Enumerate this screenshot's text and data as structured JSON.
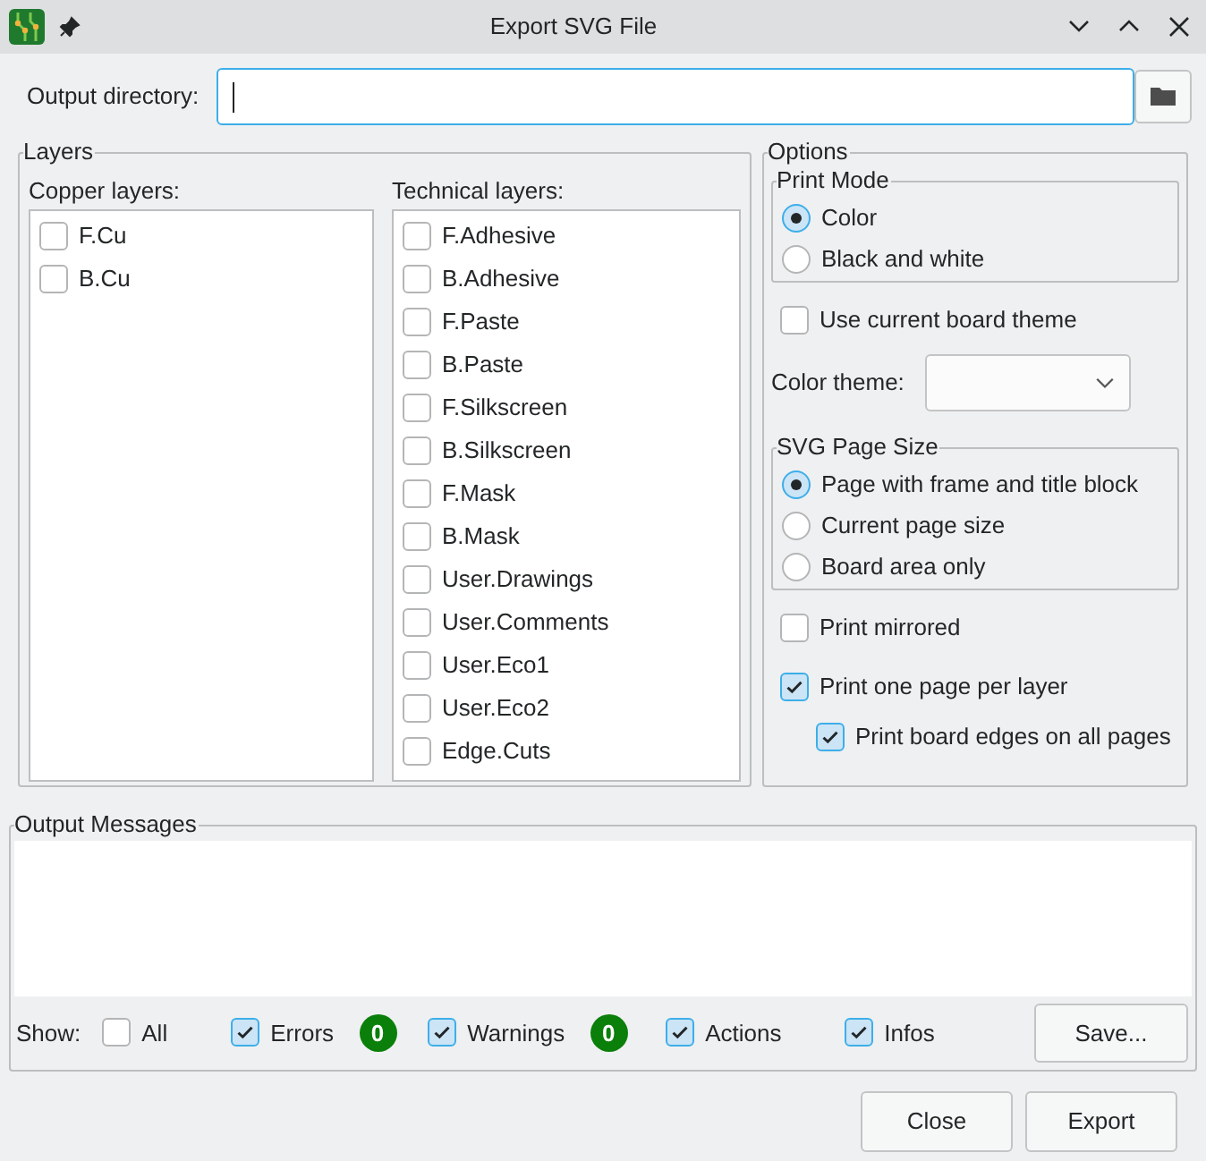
{
  "window": {
    "title": "Export SVG File"
  },
  "output_directory": {
    "label": "Output directory:"
  },
  "layers": {
    "title": "Layers",
    "copper": {
      "title": "Copper layers:",
      "items": [
        {
          "label": "F.Cu",
          "checked": false
        },
        {
          "label": "B.Cu",
          "checked": false
        }
      ]
    },
    "technical": {
      "title": "Technical layers:",
      "items": [
        {
          "label": "F.Adhesive",
          "checked": false
        },
        {
          "label": "B.Adhesive",
          "checked": false
        },
        {
          "label": "F.Paste",
          "checked": false
        },
        {
          "label": "B.Paste",
          "checked": false
        },
        {
          "label": "F.Silkscreen",
          "checked": false
        },
        {
          "label": "B.Silkscreen",
          "checked": false
        },
        {
          "label": "F.Mask",
          "checked": false
        },
        {
          "label": "B.Mask",
          "checked": false
        },
        {
          "label": "User.Drawings",
          "checked": false
        },
        {
          "label": "User.Comments",
          "checked": false
        },
        {
          "label": "User.Eco1",
          "checked": false
        },
        {
          "label": "User.Eco2",
          "checked": false
        },
        {
          "label": "Edge.Cuts",
          "checked": false
        }
      ]
    }
  },
  "options": {
    "title": "Options",
    "print_mode": {
      "title": "Print Mode",
      "choices": [
        {
          "label": "Color",
          "selected": true
        },
        {
          "label": "Black and white",
          "selected": false
        }
      ]
    },
    "use_board_theme": {
      "label": "Use current board theme",
      "checked": false
    },
    "color_theme": {
      "label": "Color theme:"
    },
    "page_size": {
      "title": "SVG Page Size",
      "choices": [
        {
          "label": "Page with frame and title block",
          "selected": true
        },
        {
          "label": "Current page size",
          "selected": false
        },
        {
          "label": "Board area only",
          "selected": false
        }
      ]
    },
    "print_mirrored": {
      "label": "Print mirrored",
      "checked": false
    },
    "one_page_per_layer": {
      "label": "Print one page per layer",
      "checked": true
    },
    "board_edges": {
      "label": "Print board edges on all pages",
      "checked": true
    }
  },
  "messages": {
    "title": "Output Messages",
    "show_label": "Show:",
    "filters": [
      {
        "label": "All",
        "checked": false
      },
      {
        "label": "Errors",
        "checked": true,
        "count": "0"
      },
      {
        "label": "Warnings",
        "checked": true,
        "count": "0"
      },
      {
        "label": "Actions",
        "checked": true
      },
      {
        "label": "Infos",
        "checked": true
      }
    ],
    "save": "Save..."
  },
  "buttons": [
    "Close",
    "Export"
  ]
}
